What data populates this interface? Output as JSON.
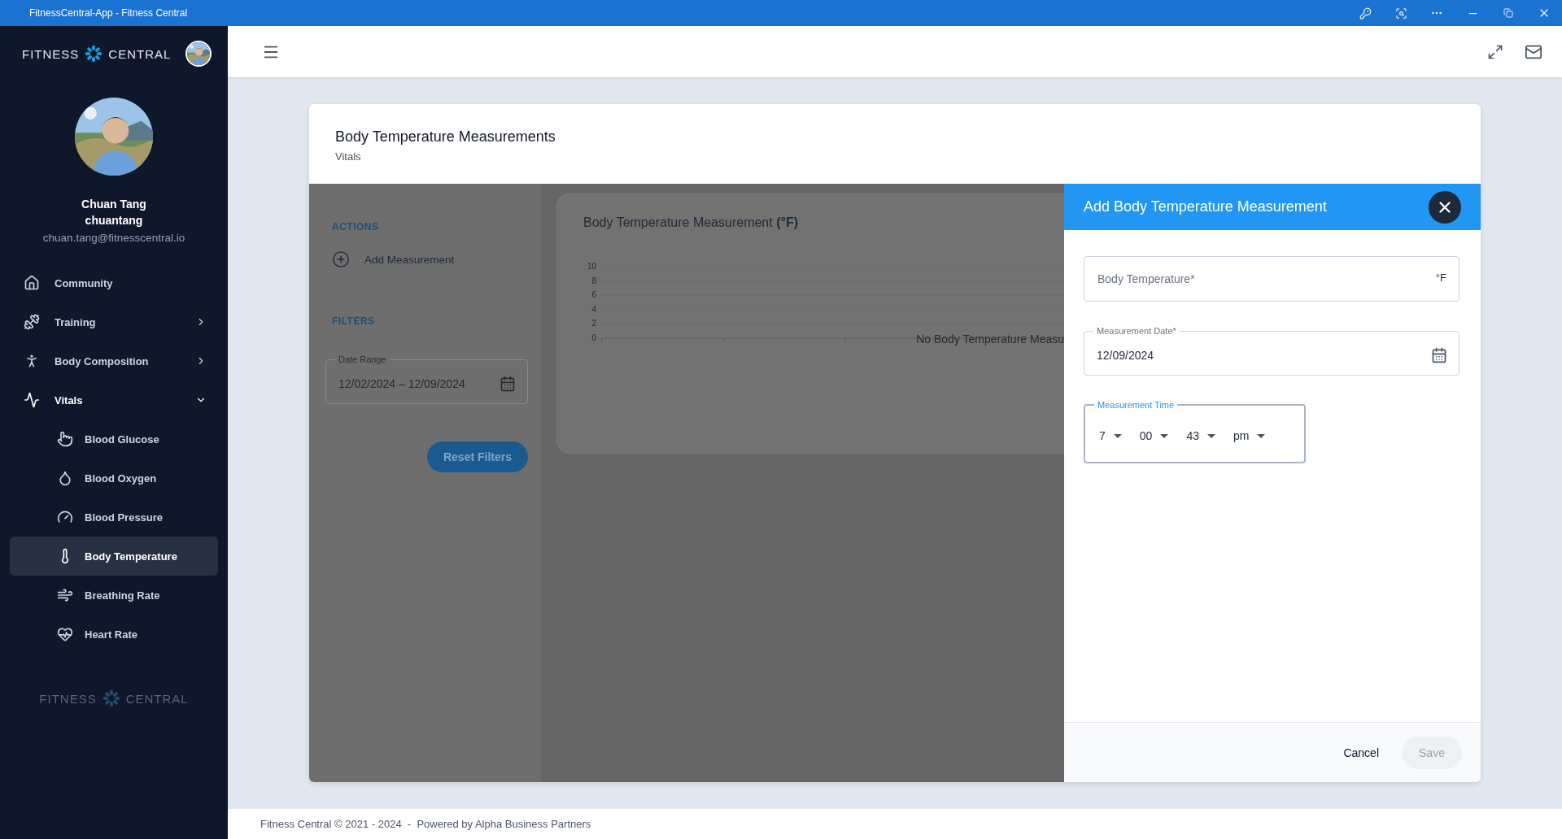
{
  "window": {
    "title": "FitnessCentral-App - Fitness Central"
  },
  "sidebar": {
    "logo": {
      "left": "FITNESS",
      "right": "CENTRAL"
    },
    "user": {
      "name": "Chuan Tang",
      "username": "chuantang",
      "email": "chuan.tang@fitnesscentral.io"
    },
    "nav": [
      {
        "kind": "link",
        "label": "Community",
        "selected": false
      },
      {
        "kind": "group",
        "label": "Training",
        "expanded": false,
        "selected": false
      },
      {
        "kind": "group",
        "label": "Body Composition",
        "expanded": false,
        "selected": false
      },
      {
        "kind": "group",
        "label": "Vitals",
        "expanded": true,
        "selected": false,
        "children": [
          {
            "label": "Blood Glucose",
            "selected": false
          },
          {
            "label": "Blood Oxygen",
            "selected": false
          },
          {
            "label": "Blood Pressure",
            "selected": false
          },
          {
            "label": "Body Temperature",
            "selected": true
          },
          {
            "label": "Breathing Rate",
            "selected": false
          },
          {
            "label": "Heart Rate",
            "selected": false
          }
        ]
      }
    ],
    "footer_logo": {
      "left": "FITNESS",
      "right": "CENTRAL"
    }
  },
  "card": {
    "title": "Body Temperature Measurements",
    "subtitle": "Vitals",
    "actions": {
      "heading": "ACTIONS",
      "items": [
        "Add Measurement"
      ]
    },
    "filters": {
      "heading": "FILTERS",
      "date_range": {
        "label": "Date Range",
        "value": "12/02/2024 – 12/09/2024"
      },
      "reset": "Reset Filters"
    },
    "chart": {
      "title": "Body Temperature Measurement  **(°F)**",
      "empty_message": "No Body Temperature Measu",
      "axis_labels": [
        "10",
        "8",
        "6",
        "4",
        "2",
        "0"
      ]
    }
  },
  "drawer": {
    "title": "Add Body Temperature Measurement",
    "temperature": {
      "placeholder": "Body Temperature*",
      "unit": "°F"
    },
    "date": {
      "label": "Measurement Date*",
      "value": "12/09/2024"
    },
    "time": {
      "label": "Measurement Time",
      "focused": true,
      "parts": [
        "7",
        "00",
        "43",
        "pm"
      ]
    },
    "buttons": [
      {
        "kind": "text",
        "label": "Cancel",
        "disabled": false
      },
      {
        "kind": "filled",
        "label": "Save",
        "disabled": true
      }
    ]
  },
  "page_footer": "Fitness Central © 2021 - 2024  -  Powered by Alpha Business Partners"
}
